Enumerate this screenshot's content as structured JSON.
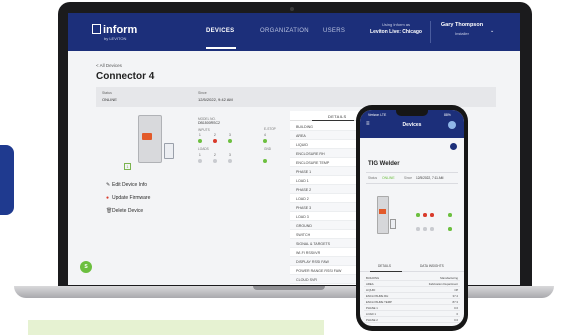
{
  "colors": {
    "header_bg": "#1c2f7a",
    "accent_green": "#6cbf3f",
    "alert_red": "#d93a2b",
    "device_orange": "#e25a2a",
    "mint_band": "#e6f2d2"
  },
  "header": {
    "logo": "inform",
    "logo_sub": "by LEVITON",
    "nav": [
      "DEVICES",
      "ORGANIZATION",
      "USERS"
    ],
    "active_nav": "DEVICES",
    "using_label": "Using Inform as",
    "using_value": "Leviton Live: Chicago",
    "user_name": "Gary Thompson",
    "user_role": "Installer"
  },
  "page": {
    "back_link": "< All Devices",
    "title": "Connector 4",
    "status_label": "Status",
    "status_value": "ONLINE",
    "since_label": "Since",
    "since_value": "12/5/2022, 9:42 AM",
    "model_label": "MODEL NO.",
    "model_value": "DB1500RSC2",
    "inputs_label": "INPUTS",
    "loads_label": "LOADS",
    "input_numbers": [
      "1",
      "2",
      "3",
      "4"
    ],
    "load_numbers": [
      "1",
      "2",
      "3"
    ],
    "emergency_label": "E-STOP",
    "gnd_label": "GND"
  },
  "actions": [
    {
      "icon": "edit-icon",
      "label": "Edit Device Info"
    },
    {
      "icon": "update-icon",
      "label": "Update Firmware"
    },
    {
      "icon": "delete-icon",
      "label": "Delete Device"
    }
  ],
  "details": {
    "tab": "DETAILS",
    "rows": [
      "BUILDING",
      "AREA",
      "LIQUID",
      "ENCLOSURE RH",
      "ENCLOSURE TEMP",
      "PHASE 1",
      "LOAD 1",
      "PHASE 2",
      "LOAD 2",
      "PHASE 3",
      "LOAD 3",
      "GROUND",
      "SWITCH",
      "SIGNAL & TARGETS",
      "WI-FI RSSI/VR",
      "DISPLAY RSSI FAW",
      "POWER RANGE RSSI FAW",
      "CLOUD SVR"
    ]
  },
  "phone": {
    "time": "12:03 PM",
    "carrier": "Verizon LTE",
    "battery": "88%",
    "title": "Devices",
    "device_name": "TIG Welder",
    "status_label": "Status",
    "status_value": "ONLINE",
    "since_label": "Since",
    "since_value": "12/5/2022, 7:11 AM",
    "tabs": [
      "DETAILS",
      "DATA INSIGHTS"
    ],
    "rows": [
      {
        "label": "BUILDING",
        "value": "Manufacturing"
      },
      {
        "label": "AREA",
        "value": "Fabrication Department"
      },
      {
        "label": "LIQUID",
        "value": "Off"
      },
      {
        "label": "ENCLOSURE RH",
        "value": "37.4"
      },
      {
        "label": "ENCLOSURE TEMP",
        "value": "87.3"
      },
      {
        "label": "PHASE 1",
        "value": "0.0"
      },
      {
        "label": "LOAD 1",
        "value": "0"
      },
      {
        "label": "PHASE 2",
        "value": "0.0"
      }
    ]
  },
  "fab_label": "S"
}
